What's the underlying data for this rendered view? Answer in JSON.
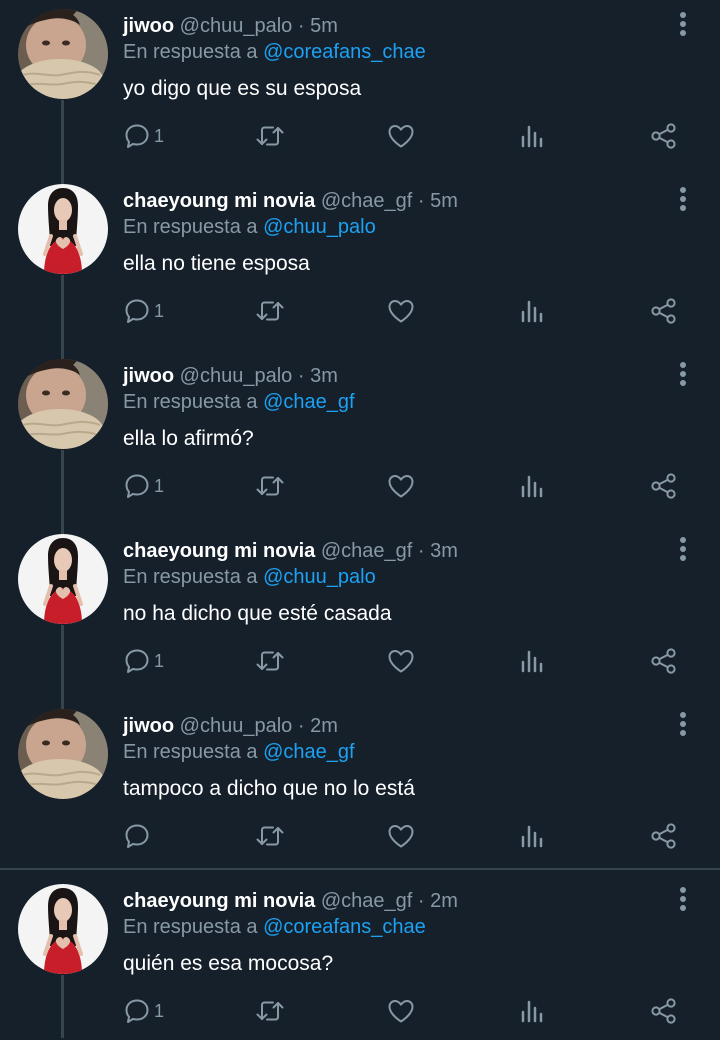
{
  "reply_prefix": "En respuesta a",
  "dot": "·",
  "colors": {
    "background": "#15202b",
    "accent": "#1da1f2",
    "muted": "#8899a6",
    "line": "#38444d"
  },
  "icons": {
    "reply": "comment-icon",
    "retweet": "retweet-icon",
    "like": "heart-icon",
    "stats": "bar-chart-icon",
    "share": "share-icon",
    "more": "more-vertical-icon"
  },
  "tweets": [
    {
      "name": "jiwoo",
      "handle": "@chuu_palo",
      "time": "5m",
      "reply_to": "@coreafans_chae",
      "text": "yo digo que es su esposa",
      "reply_count": "1",
      "avatar": "jiwoo"
    },
    {
      "name": "chaeyoung mi novia",
      "handle": "@chae_gf",
      "time": "5m",
      "reply_to": "@chuu_palo",
      "text": "ella no tiene esposa",
      "reply_count": "1",
      "avatar": "chaeyoung"
    },
    {
      "name": "jiwoo",
      "handle": "@chuu_palo",
      "time": "3m",
      "reply_to": "@chae_gf",
      "text": "ella lo afirmó?",
      "reply_count": "1",
      "avatar": "jiwoo"
    },
    {
      "name": "chaeyoung mi novia",
      "handle": "@chae_gf",
      "time": "3m",
      "reply_to": "@chuu_palo",
      "text": "no ha dicho que esté casada",
      "reply_count": "1",
      "avatar": "chaeyoung"
    },
    {
      "name": "jiwoo",
      "handle": "@chuu_palo",
      "time": "2m",
      "reply_to": "@chae_gf",
      "text": "tampoco a dicho que no lo está",
      "reply_count": "",
      "avatar": "jiwoo"
    },
    {
      "name": "chaeyoung mi novia",
      "handle": "@chae_gf",
      "time": "2m",
      "reply_to": "@coreafans_chae",
      "text": "quién es esa mocosa?",
      "reply_count": "1",
      "avatar": "chaeyoung"
    }
  ]
}
